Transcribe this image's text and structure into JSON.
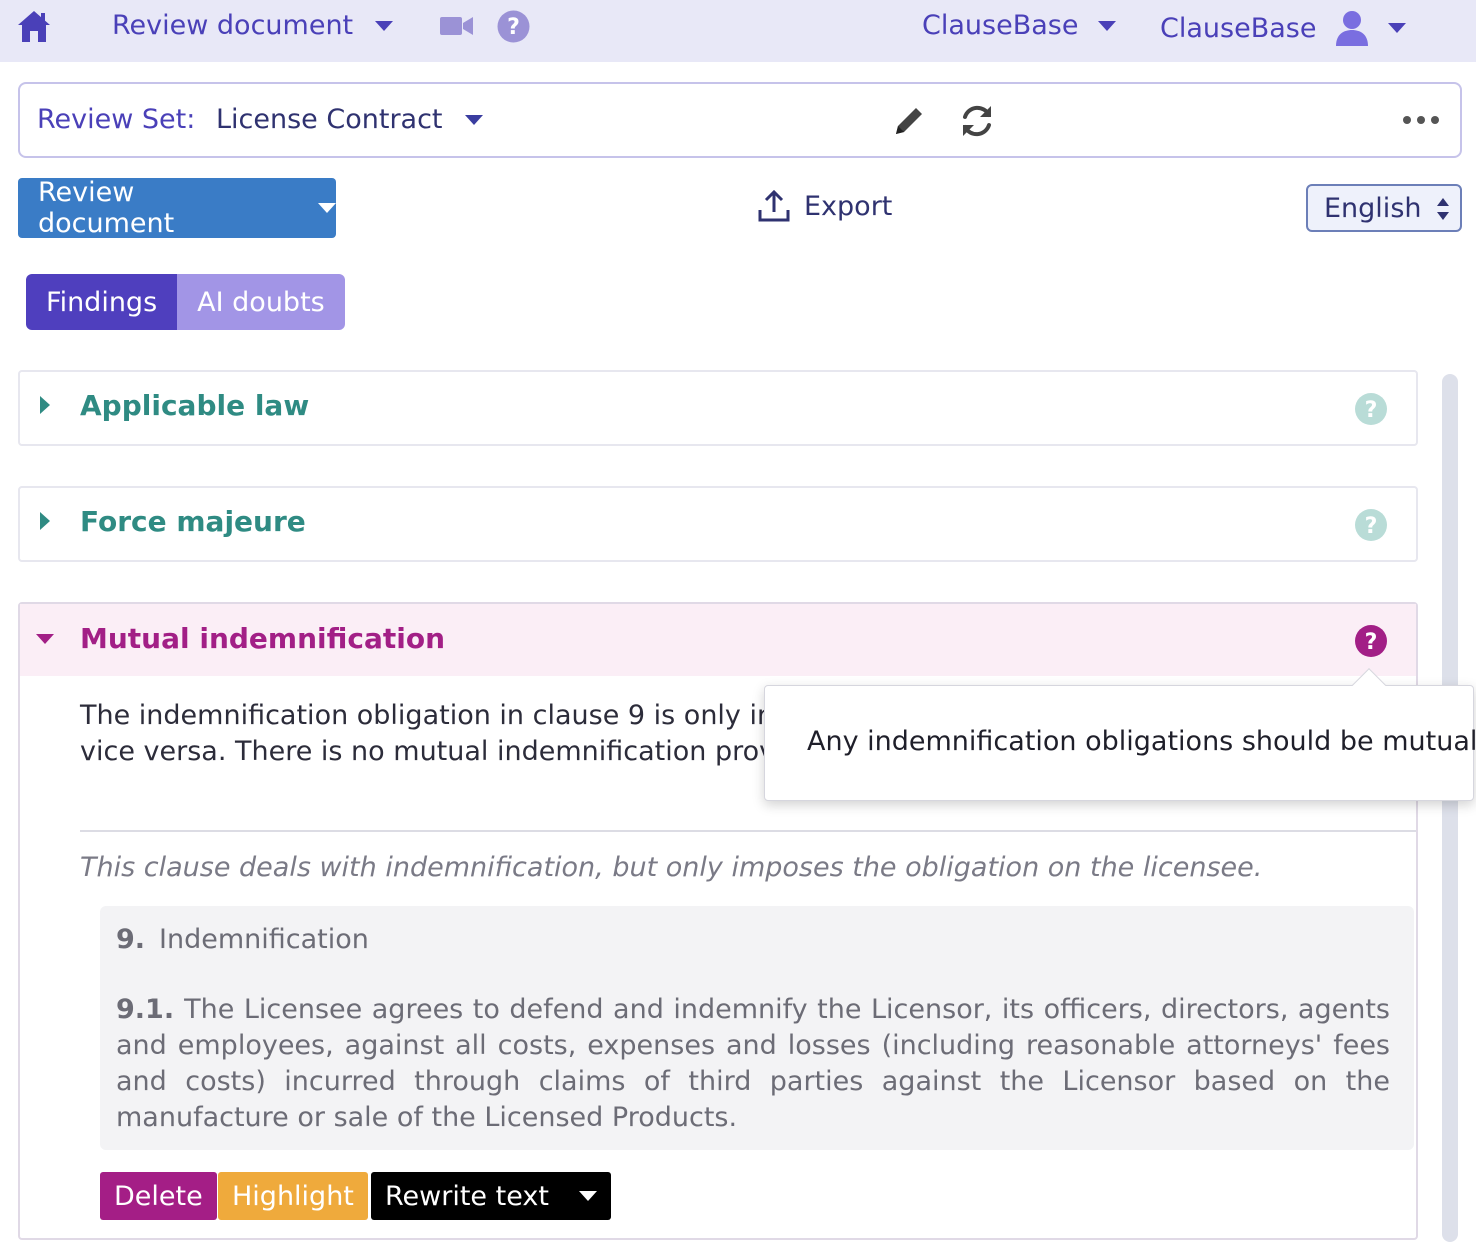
{
  "topbar": {
    "nav_title": "Review document",
    "workspace": "ClauseBase",
    "user": "ClauseBase",
    "icons": [
      "home-icon",
      "video-camera-icon",
      "help-icon",
      "user-icon"
    ]
  },
  "review_set": {
    "label": "Review Set:",
    "value": "License Contract"
  },
  "actions": {
    "review_button": "Review document",
    "export": "Export",
    "language": "English"
  },
  "tabs": [
    {
      "label": "Findings",
      "active": true
    },
    {
      "label": "AI doubts",
      "active": false
    }
  ],
  "panels": [
    {
      "title": "Applicable law",
      "expanded": false
    },
    {
      "title": "Force majeure",
      "expanded": false
    },
    {
      "title": "Mutual indemnification",
      "expanded": true,
      "description_line1": "The indemnification obligation in clause 9 is only impos",
      "description_line2": "vice versa. There is no mutual indemnification provision",
      "note": "This clause deals with indemnification, but only imposes the obligation on the licensee.",
      "clause": {
        "heading_num": "9.",
        "heading_text": "Indemnification",
        "body_num": "9.1.",
        "body_text": "The Licensee agrees to defend and indemnify the Licensor, its officers, directors, agents and employees, against all costs, expenses and losses (including reasonable attorneys' fees and costs) incurred through claims of third parties against the Licensor based on the manufacture or sale of the Licensed Products."
      },
      "buttons": {
        "delete": "Delete",
        "highlight": "Highlight",
        "rewrite": "Rewrite text"
      }
    }
  ],
  "tooltip": {
    "text": "Any indemnification obligations should be mutual."
  },
  "colors": {
    "topbar_bg": "#e8e8f7",
    "brand": "#4a40b8",
    "teal": "#2f8b83",
    "magenta": "#a21f86",
    "review_blue": "#3a7cc6",
    "highlight": "#efaa3c"
  }
}
